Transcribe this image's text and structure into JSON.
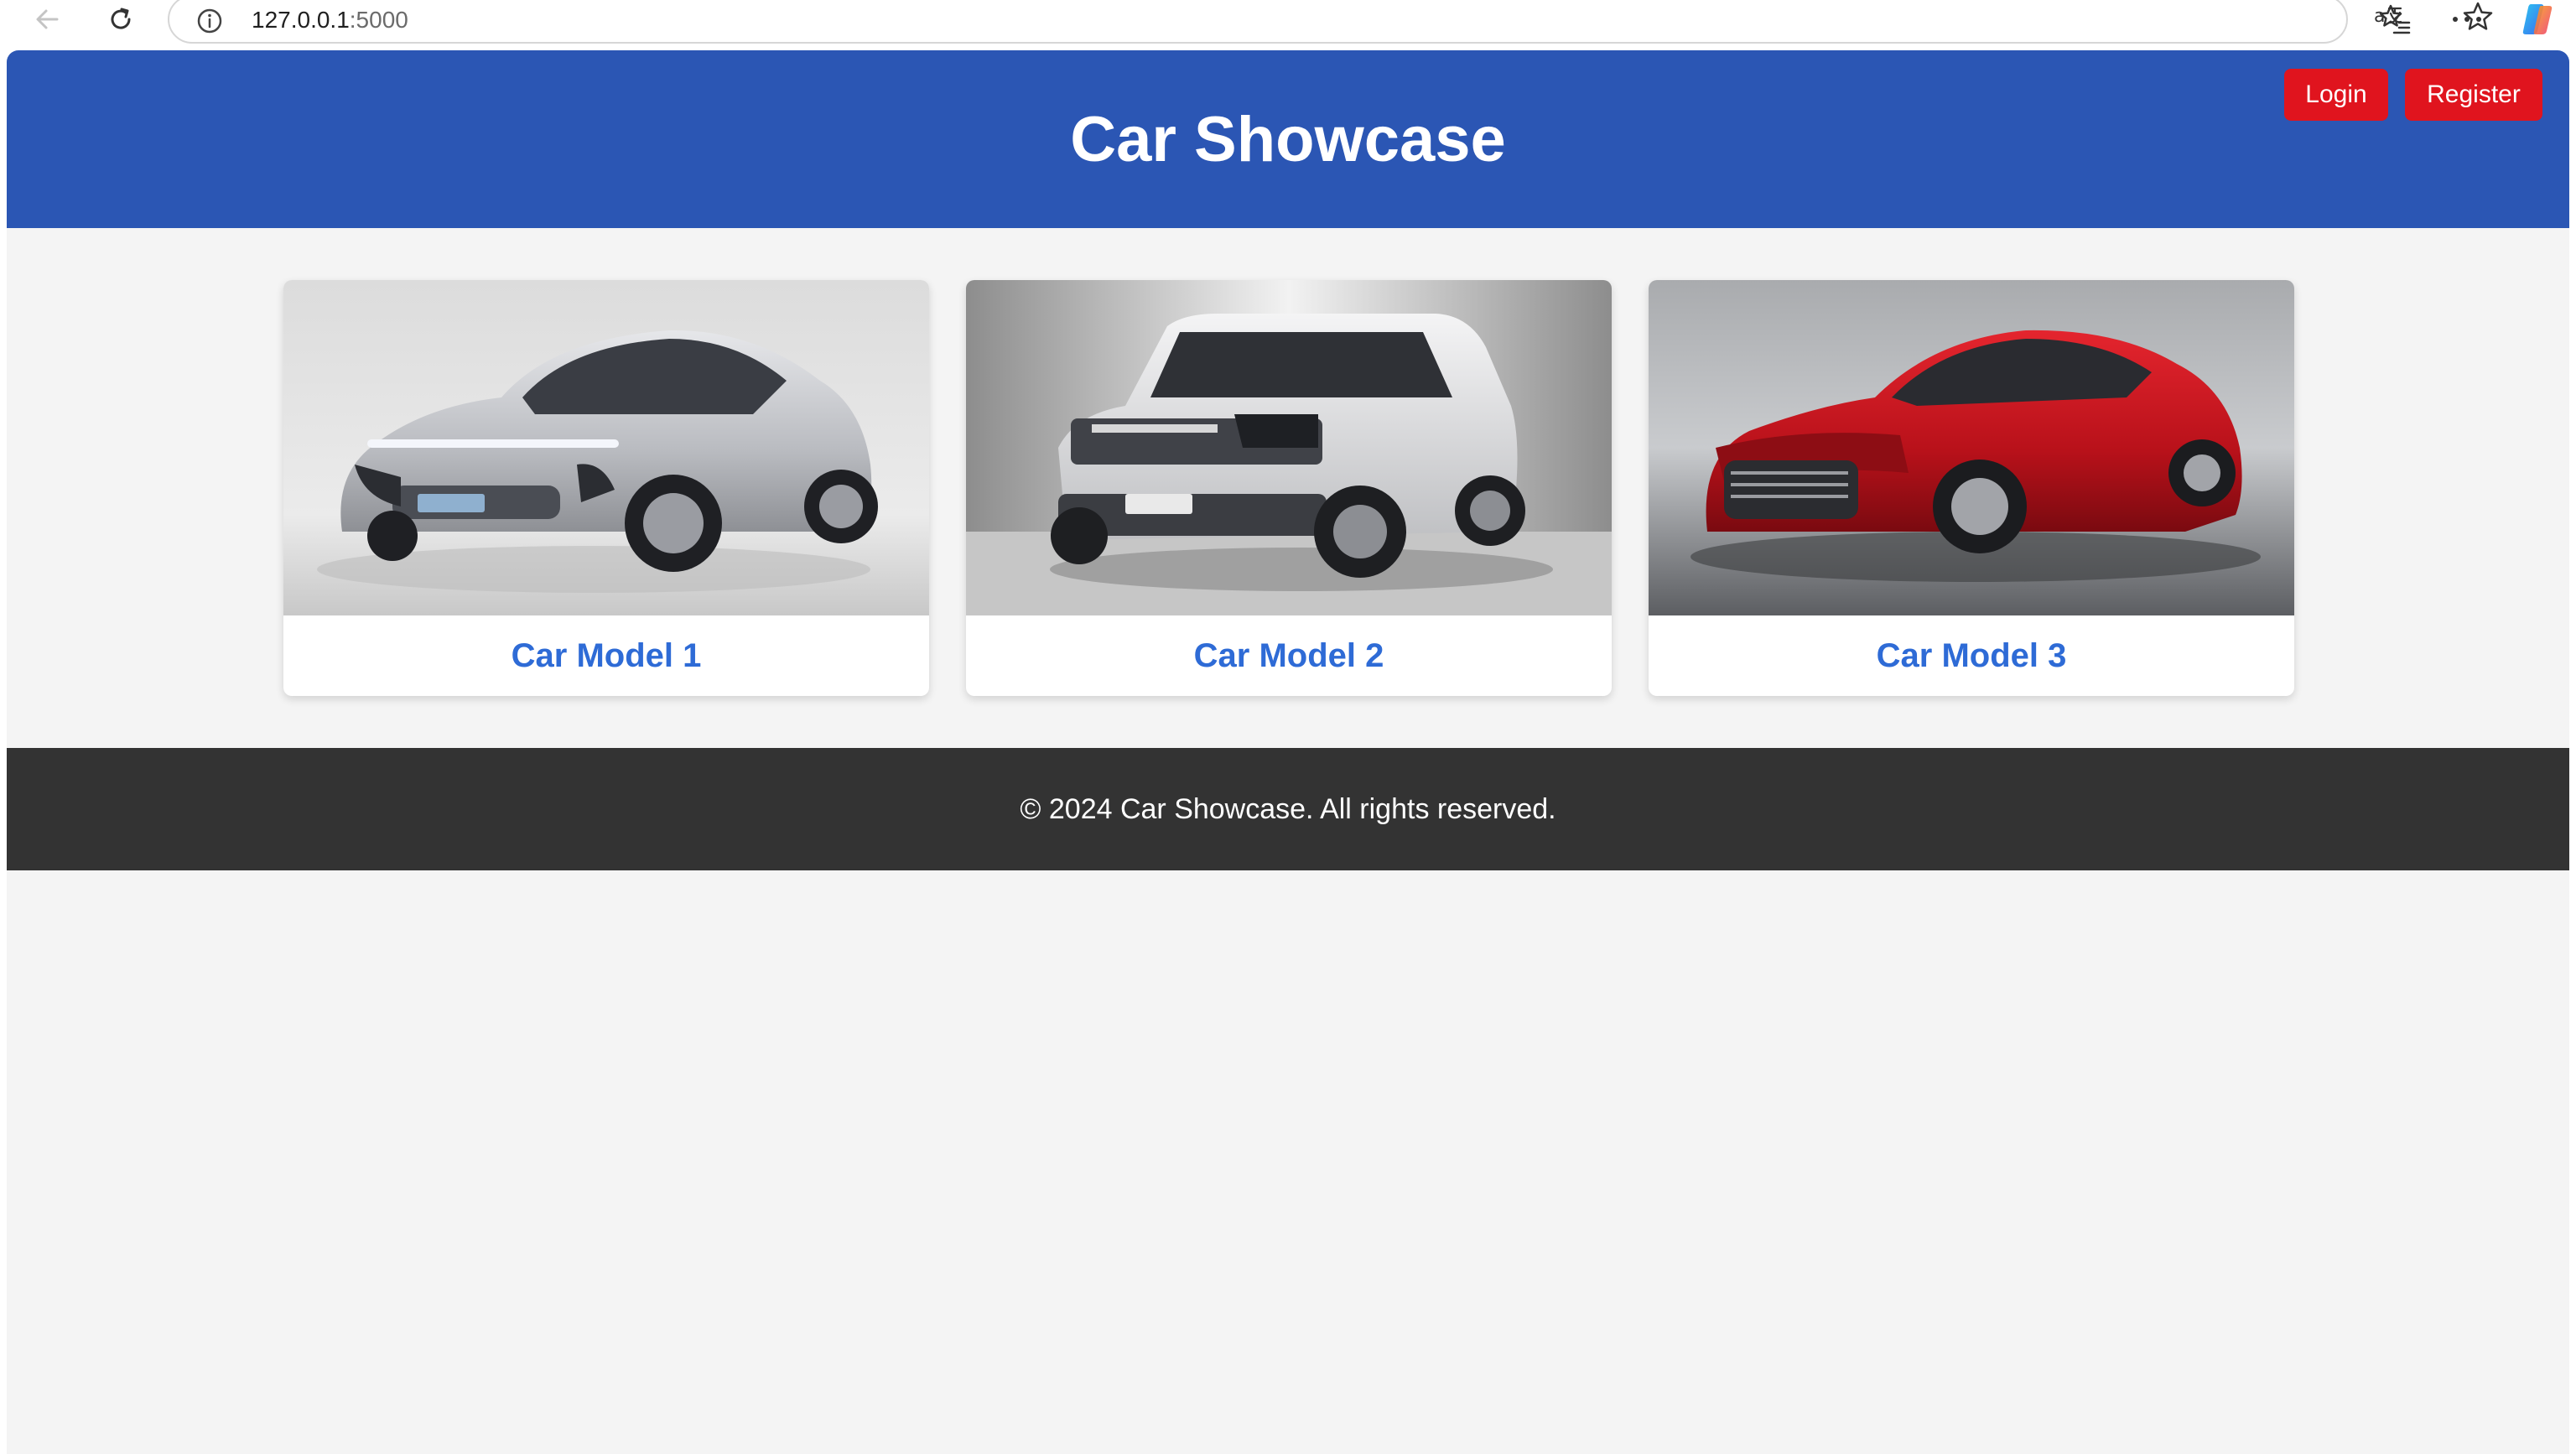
{
  "browser": {
    "url_host": "127.0.0.1",
    "url_port": ":5000",
    "icons": [
      "back-arrow-icon",
      "reload-icon",
      "info-icon",
      "translate-icon",
      "star-icon",
      "favorites-icon",
      "more-icon",
      "copilot-icon"
    ]
  },
  "header": {
    "title": "Car Showcase",
    "login_label": "Login",
    "register_label": "Register"
  },
  "cars": [
    {
      "title": "Car Model 1",
      "color": "#c9cbcf"
    },
    {
      "title": "Car Model 2",
      "color": "#e2e3e5"
    },
    {
      "title": "Car Model 3",
      "color": "#c8141e"
    }
  ],
  "footer": {
    "text": "© 2024 Car Showcase. All rights reserved."
  },
  "colors": {
    "header_bg": "#2b56b4",
    "button_bg": "#e0141e",
    "card_title": "#2e6bd6",
    "footer_bg": "#333333",
    "page_bg": "#f4f4f4"
  }
}
